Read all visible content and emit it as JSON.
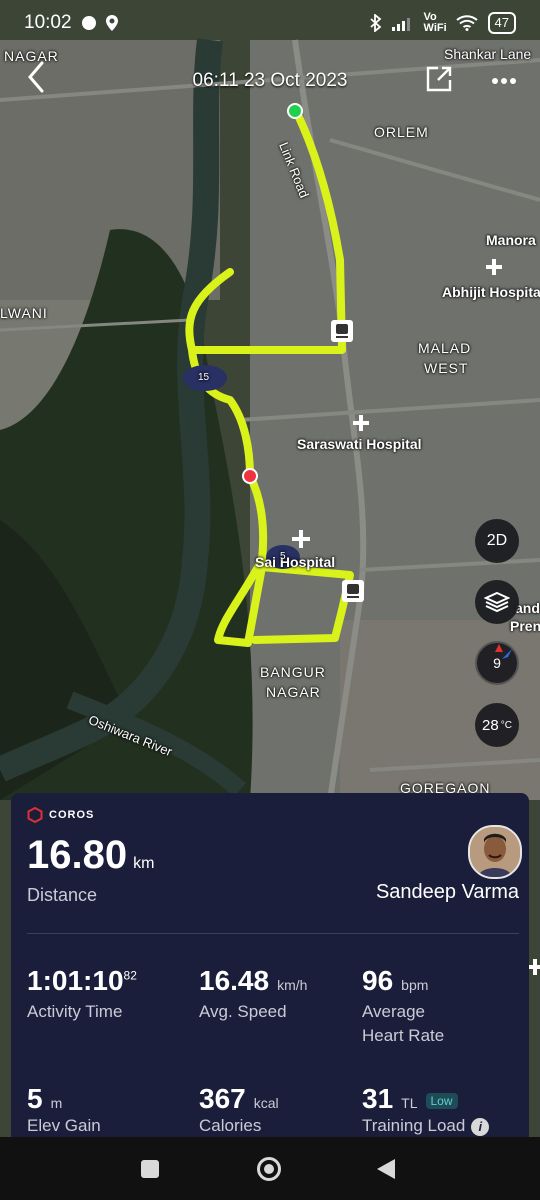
{
  "status_bar": {
    "time": "10:02",
    "network": "Vo WiFi",
    "battery": "47"
  },
  "header": {
    "date": "06:11 23 Oct 2023"
  },
  "map": {
    "labels": {
      "nagar": "NAGAR",
      "shankar_lane": "Shankar Lane",
      "orlem": "ORLEM",
      "link_road": "Link Road",
      "manora": "Manora",
      "abhijit_hospital": "Abhijit Hospita",
      "malwani": "LWANI",
      "malad_west_1": "MALAD",
      "malad_west_2": "WEST",
      "saraswati_hospital": "Saraswati Hospital",
      "sai_hospital": "Sai Hospital",
      "bangur_nagar_1": "BANGUR",
      "bangur_nagar_2": "NAGAR",
      "oshiwara_river": "Oshiwara River",
      "goregaon": "GOREGAON",
      "prem_1": "and S",
      "prem_2": "Pren",
      "km_15": "15",
      "km_5": "5"
    },
    "buttons": {
      "view_mode": "2D",
      "compass_value": "9",
      "temperature": "28",
      "temperature_unit": "°C"
    }
  },
  "card": {
    "brand": "COROS",
    "distance_value": "16.80",
    "distance_unit": "km",
    "distance_label": "Distance",
    "user_name": "Sandeep Varma",
    "activity_time": "1:01:10",
    "activity_time_sub": "82",
    "activity_time_label": "Activity Time",
    "avg_speed": "16.48",
    "avg_speed_unit": "km/h",
    "avg_speed_label": "Avg. Speed",
    "heart_rate": "96",
    "heart_rate_unit": "bpm",
    "heart_rate_label_1": "Average",
    "heart_rate_label_2": "Heart Rate",
    "elev_gain": "5",
    "elev_gain_unit": "m",
    "elev_gain_label": "Elev Gain",
    "calories": "367",
    "calories_unit": "kcal",
    "calories_label": "Calories",
    "training_load": "31",
    "training_load_unit": "TL",
    "training_load_badge": "Low",
    "training_load_label": "Training Load"
  },
  "colors": {
    "route": "#d8f21a",
    "card_bg": "#1a1e3a",
    "brand_red": "#e0302f"
  }
}
